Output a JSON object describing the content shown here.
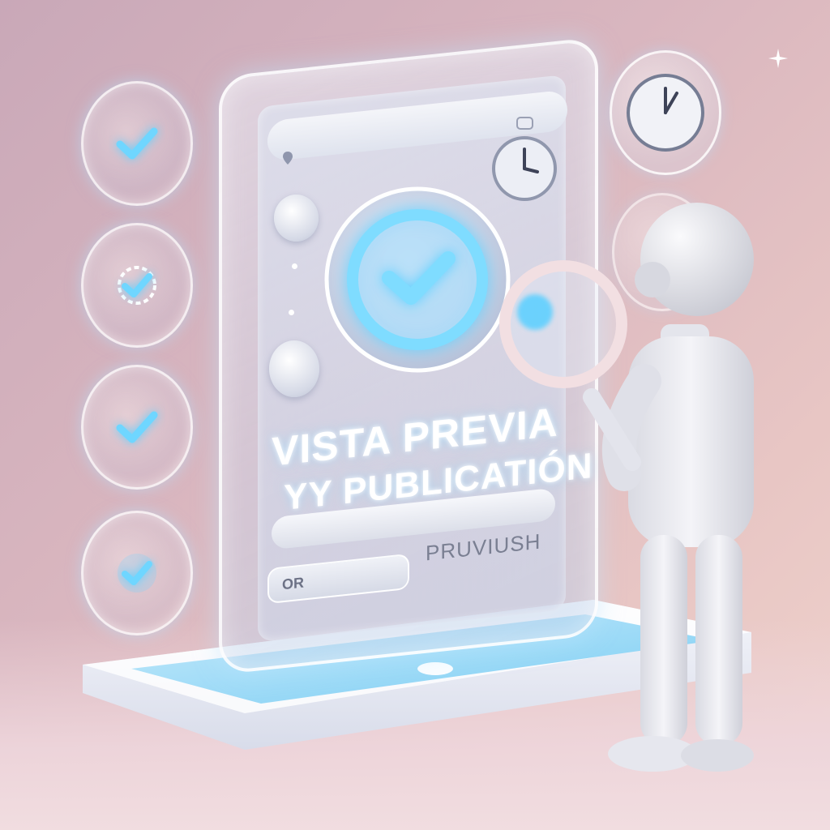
{
  "panel": {
    "title_line1": "VISTA PREVIA",
    "title_line2": "YY PUBLICATIÓN",
    "publish_label": "PRUVIUSH",
    "button_label": "OR"
  },
  "icons": {
    "left_discs": [
      "check-icon",
      "badge-check-icon",
      "check-icon",
      "check-icon"
    ],
    "main": "check-circle-icon",
    "stopwatch": "stopwatch-icon",
    "clock": "clock-icon",
    "magnifier": "magnifying-glass-icon"
  },
  "colors": {
    "accent_glow": "#5fd0ff",
    "background": "#d9b6bf",
    "figure": "#e9e9ee"
  }
}
